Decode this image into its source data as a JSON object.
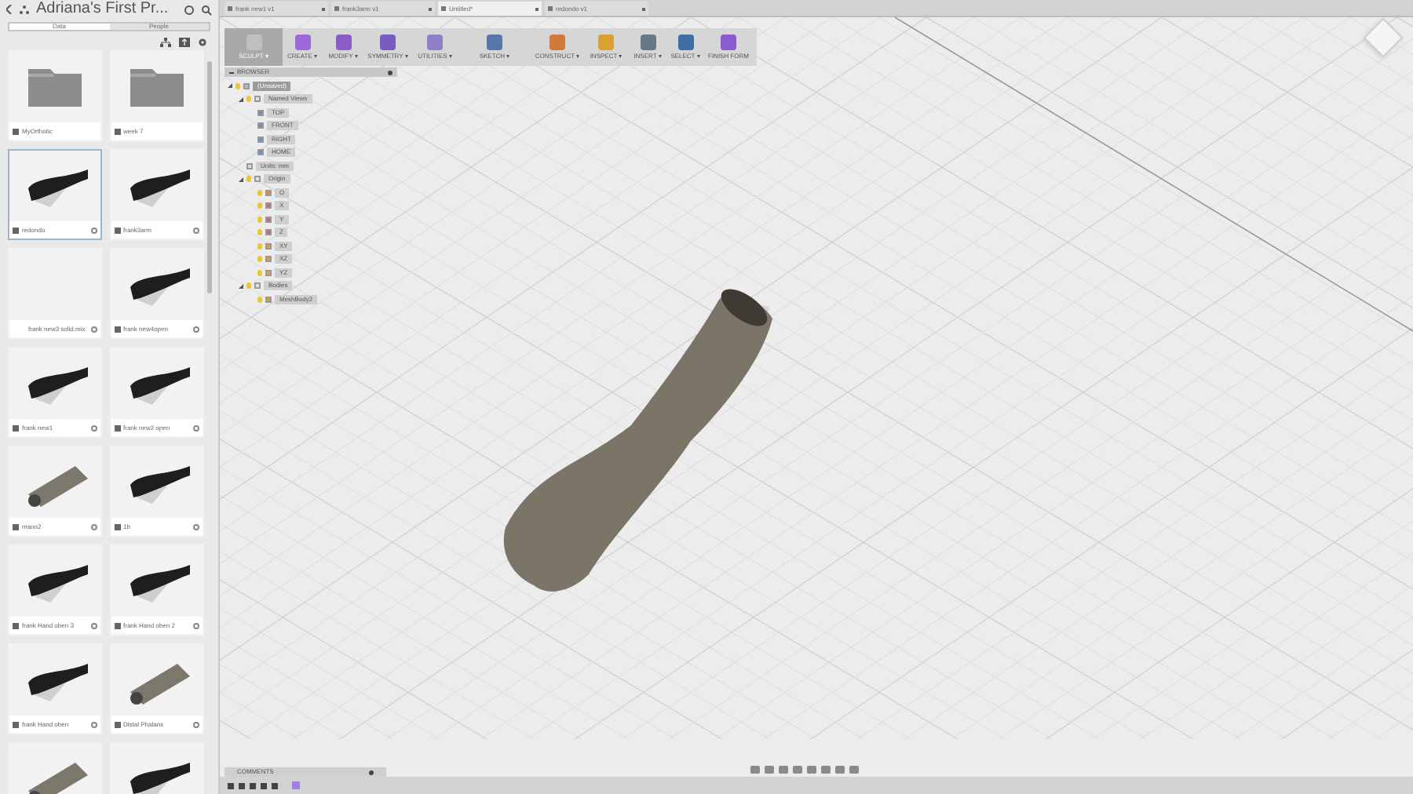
{
  "project": {
    "title": "Adriana's First Pr..."
  },
  "panel_tabs": [
    {
      "label": "Data",
      "selected": true
    },
    {
      "label": "People",
      "selected": false
    }
  ],
  "files": [
    {
      "name": "MyOrthotic",
      "kind": "folder",
      "selected": false
    },
    {
      "name": "week 7",
      "kind": "folder",
      "selected": false
    },
    {
      "name": "redondo",
      "kind": "model",
      "selected": true
    },
    {
      "name": "frank3arm",
      "kind": "model",
      "selected": false
    },
    {
      "name": "frank new3 solid.mix",
      "kind": "blank",
      "selected": false
    },
    {
      "name": "frank new4open",
      "kind": "model",
      "selected": false
    },
    {
      "name": "frank new1",
      "kind": "model",
      "selected": false
    },
    {
      "name": "frank new2 open",
      "kind": "model",
      "selected": false
    },
    {
      "name": "mano2",
      "kind": "cylinder",
      "selected": false
    },
    {
      "name": "1b",
      "kind": "model",
      "selected": false
    },
    {
      "name": "frank Hand oben 3",
      "kind": "model",
      "selected": false
    },
    {
      "name": "frank Hand oben 2",
      "kind": "model",
      "selected": false
    },
    {
      "name": "frank Hand oben",
      "kind": "model",
      "selected": false
    },
    {
      "name": "Distal Phalanx",
      "kind": "cylinder",
      "selected": false
    },
    {
      "kind": "cylinder",
      "selected": false
    },
    {
      "kind": "model",
      "selected": false
    }
  ],
  "document_tabs": [
    {
      "label": "frank new1 v1",
      "selected": false
    },
    {
      "label": "frank3arm v1",
      "selected": false
    },
    {
      "label": "Untitled*",
      "selected": true
    },
    {
      "label": "redondo v1",
      "selected": false
    }
  ],
  "toolbar": [
    {
      "label": "SCULPT ▾",
      "selected": true
    },
    {
      "label": "CREATE ▾",
      "selected": false
    },
    {
      "label": "MODIFY ▾",
      "selected": false
    },
    {
      "label": "SYMMETRY ▾",
      "selected": false
    },
    {
      "label": "UTILITIES ▾",
      "selected": false
    },
    {
      "label": "SKETCH ▾",
      "selected": false
    },
    {
      "label": "CONSTRUCT ▾",
      "selected": false
    },
    {
      "label": "INSPECT ▾",
      "selected": false
    },
    {
      "label": "INSERT ▾",
      "selected": false
    },
    {
      "label": "SELECT ▾",
      "selected": false
    },
    {
      "label": "FINISH FORM",
      "selected": false
    }
  ],
  "browser": {
    "title": "BROWSER",
    "tree": [
      {
        "label": "(Unsaved)",
        "kind": "root",
        "expanded": true,
        "children": [
          {
            "label": "Named Views",
            "kind": "folder",
            "expanded": true,
            "children": [
              {
                "label": "TOP",
                "kind": "view"
              },
              {
                "label": "FRONT",
                "kind": "view"
              },
              {
                "label": "RIGHT",
                "kind": "view"
              },
              {
                "label": "HOME",
                "kind": "view"
              }
            ]
          },
          {
            "label": "Units: mm",
            "kind": "units"
          },
          {
            "label": "Origin",
            "kind": "folder",
            "expanded": true,
            "children": [
              {
                "label": "O",
                "kind": "point"
              },
              {
                "label": "X",
                "kind": "axis"
              },
              {
                "label": "Y",
                "kind": "axis"
              },
              {
                "label": "Z",
                "kind": "axis"
              },
              {
                "label": "XY",
                "kind": "plane"
              },
              {
                "label": "XZ",
                "kind": "plane"
              },
              {
                "label": "YZ",
                "kind": "plane"
              }
            ]
          },
          {
            "label": "Bodies",
            "kind": "folder",
            "expanded": true,
            "children": [
              {
                "label": "MeshBody2",
                "kind": "body"
              }
            ]
          }
        ]
      }
    ]
  },
  "comments": {
    "title": "COMMENTS"
  }
}
